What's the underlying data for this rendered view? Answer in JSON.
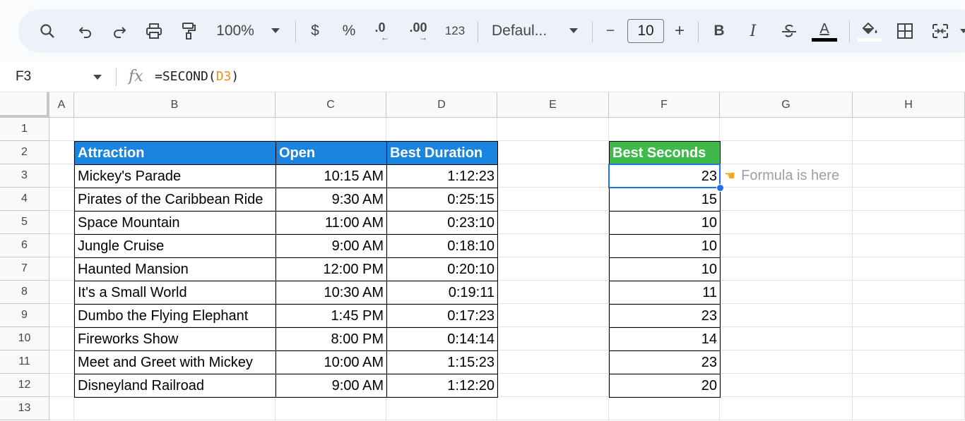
{
  "toolbar": {
    "zoom": "100%",
    "currency": "$",
    "percent": "%",
    "decrease_decimal": ".0",
    "increase_decimal": ".00",
    "number_format": "123",
    "font": "Defaul...",
    "font_size": "10",
    "minus": "−",
    "plus": "+",
    "bold": "B",
    "italic": "I",
    "text_color": "A"
  },
  "formula_bar": {
    "cell_ref": "F3",
    "fx": "fx",
    "formula_prefix": "=SECOND(",
    "formula_ref": "D3",
    "formula_suffix": ")"
  },
  "columns": [
    "A",
    "B",
    "C",
    "D",
    "E",
    "F",
    "G",
    "H"
  ],
  "rows": [
    "1",
    "2",
    "3",
    "4",
    "5",
    "6",
    "7",
    "8",
    "9",
    "10",
    "11",
    "12",
    "13"
  ],
  "table": {
    "headers": [
      "Attraction",
      "Open",
      "Best Duration"
    ],
    "rows": [
      [
        "Mickey's Parade",
        "10:15 AM",
        "1:12:23"
      ],
      [
        "Pirates of the Caribbean Ride",
        "9:30 AM",
        "0:25:15"
      ],
      [
        "Space Mountain",
        "11:00 AM",
        "0:23:10"
      ],
      [
        "Jungle Cruise",
        "9:00 AM",
        "0:18:10"
      ],
      [
        "Haunted Mansion",
        "12:00 PM",
        "0:20:10"
      ],
      [
        "It's a Small World",
        "10:30 AM",
        "0:19:11"
      ],
      [
        "Dumbo the Flying Elephant",
        "1:45 PM",
        "0:17:23"
      ],
      [
        "Fireworks Show",
        "8:00 PM",
        "0:14:14"
      ],
      [
        "Meet and Greet with Mickey",
        "10:00 AM",
        "1:15:23"
      ],
      [
        "Disneyland Railroad",
        "9:00 AM",
        "1:12:20"
      ]
    ]
  },
  "seconds": {
    "header": "Best Seconds",
    "values": [
      "23",
      "15",
      "10",
      "10",
      "10",
      "11",
      "23",
      "14",
      "23",
      "20"
    ]
  },
  "note": {
    "icon": "pointing-hand-icon",
    "text": "Formula is here"
  },
  "colors": {
    "header_blue": "#1a85e0",
    "header_green": "#3eb94a",
    "selection": "#1a73e8"
  }
}
